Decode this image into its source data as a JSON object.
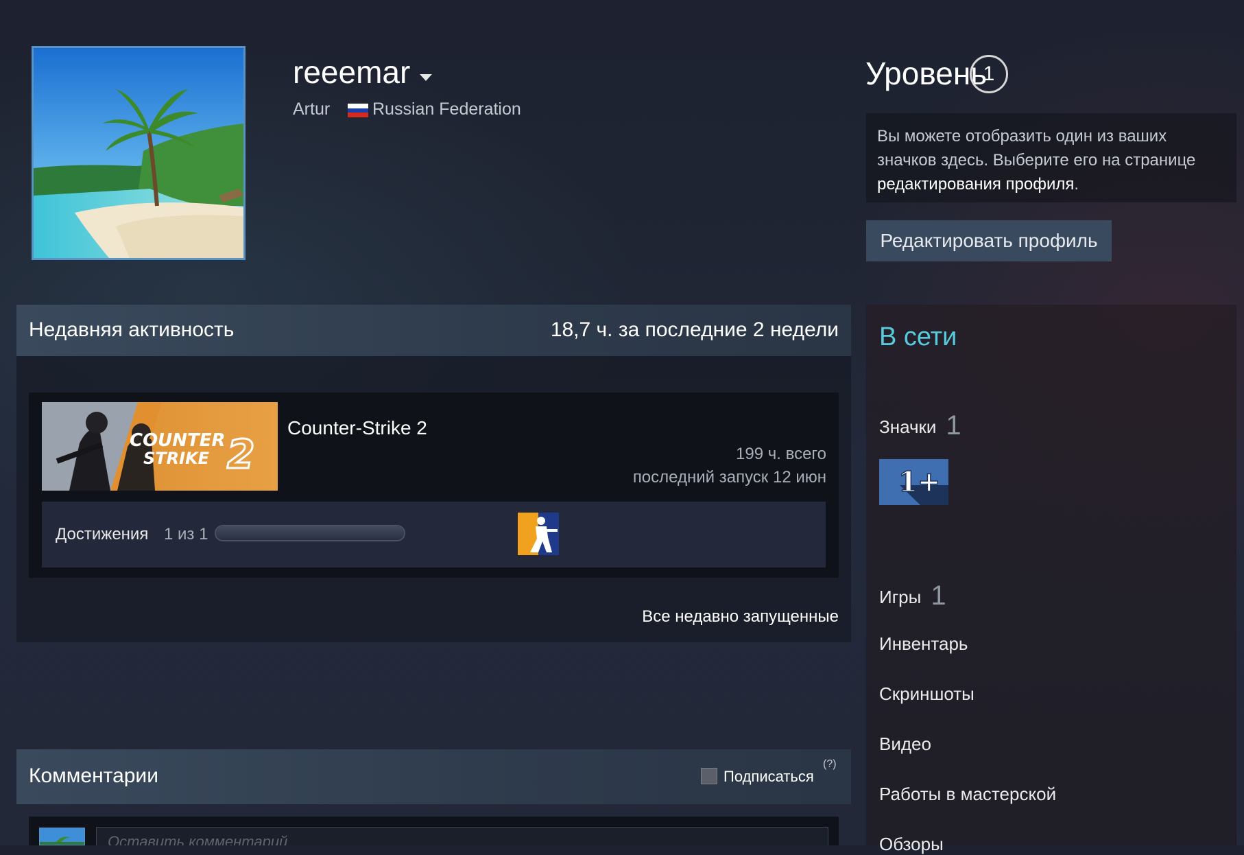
{
  "profile": {
    "persona_name": "reeemar",
    "real_name": "Artur",
    "country": "Russian Federation",
    "flag_colors": [
      "#ffffff",
      "#1c3faa",
      "#d52b1e"
    ]
  },
  "level": {
    "label": "Уровень",
    "value": "1",
    "badge_info_text": "Вы можете отобразить один из ваших значков здесь. Выберите его на странице",
    "badge_info_link": "редактирования профиля",
    "badge_info_end": ".",
    "edit_button": "Редактировать профиль"
  },
  "recent_activity": {
    "title": "Недавняя активность",
    "hours": "18,7 ч. за последние 2 недели",
    "game": {
      "name": "Counter-Strike 2",
      "capsule_text": [
        "COUNTER",
        "STRIKE"
      ],
      "capsule_number": "2",
      "total": "199 ч. всего",
      "last_played": "последний запуск 12 июн",
      "achievements_label": "Достижения",
      "achievements_count": "1 из 1",
      "achievements_progress": 1.0
    },
    "all_recent_link": "Все недавно запущенные"
  },
  "comments": {
    "title": "Комментарии",
    "subscribe_label": "Подписаться",
    "help": "(?)",
    "input_placeholder": "Оставить комментарий"
  },
  "sidebar": {
    "status": "В сети",
    "status_color": "#57cbde",
    "badges_label": "Значки",
    "badges_count": "1",
    "badge_text": "1+",
    "games_label": "Игры",
    "games_count": "1",
    "links": [
      "Инвентарь",
      "Скриншоты",
      "Видео",
      "Работы в мастерской",
      "Обзоры"
    ]
  }
}
